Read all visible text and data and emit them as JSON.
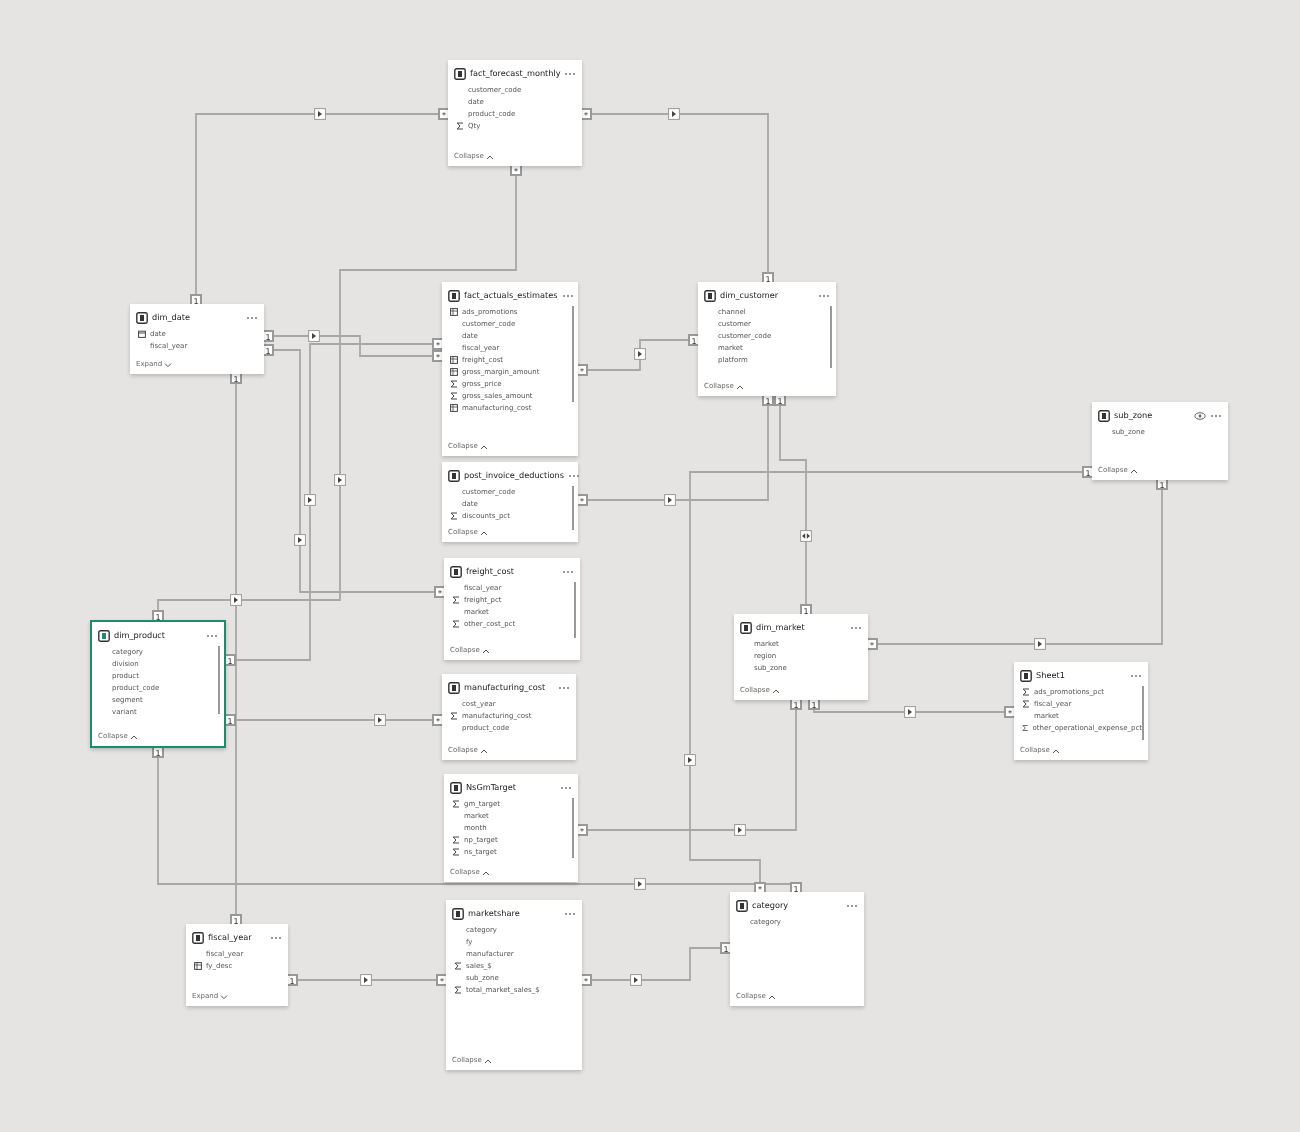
{
  "tables": [
    {
      "name": "fact_forecast_monthly",
      "selected": false,
      "hidden": false,
      "expanded": true,
      "footer": "Collapse",
      "fields": [
        {
          "name": "customer_code",
          "kind": "column"
        },
        {
          "name": "date",
          "kind": "column"
        },
        {
          "name": "product_code",
          "kind": "column"
        },
        {
          "name": "Qty",
          "kind": "measure"
        }
      ]
    },
    {
      "name": "dim_date",
      "selected": false,
      "hidden": false,
      "expanded": false,
      "footer": "Expand",
      "fields": [
        {
          "name": "date",
          "kind": "date"
        },
        {
          "name": "fiscal_year",
          "kind": "column"
        }
      ]
    },
    {
      "name": "fact_actuals_estimates",
      "selected": false,
      "hidden": false,
      "expanded": true,
      "footer": "Collapse",
      "fields": [
        {
          "name": "ads_promotions",
          "kind": "calculated"
        },
        {
          "name": "customer_code",
          "kind": "column"
        },
        {
          "name": "date",
          "kind": "column"
        },
        {
          "name": "fiscal_year",
          "kind": "column"
        },
        {
          "name": "freight_cost",
          "kind": "calculated"
        },
        {
          "name": "gross_margin_amount",
          "kind": "calculated"
        },
        {
          "name": "gross_price",
          "kind": "measure"
        },
        {
          "name": "gross_sales_amount",
          "kind": "measure"
        },
        {
          "name": "manufacturing_cost",
          "kind": "calculated"
        }
      ]
    },
    {
      "name": "post_invoice_deductions",
      "selected": false,
      "hidden": false,
      "expanded": true,
      "footer": "Collapse",
      "fields": [
        {
          "name": "customer_code",
          "kind": "column"
        },
        {
          "name": "date",
          "kind": "column"
        },
        {
          "name": "discounts_pct",
          "kind": "measure"
        }
      ]
    },
    {
      "name": "freight_cost",
      "selected": false,
      "hidden": false,
      "expanded": true,
      "footer": "Collapse",
      "fields": [
        {
          "name": "fiscal_year",
          "kind": "column"
        },
        {
          "name": "freight_pct",
          "kind": "measure"
        },
        {
          "name": "market",
          "kind": "column"
        },
        {
          "name": "other_cost_pct",
          "kind": "measure"
        }
      ]
    },
    {
      "name": "manufacturing_cost",
      "selected": false,
      "hidden": false,
      "expanded": true,
      "footer": "Collapse",
      "fields": [
        {
          "name": "cost_year",
          "kind": "column"
        },
        {
          "name": "manufacturing_cost",
          "kind": "measure"
        },
        {
          "name": "product_code",
          "kind": "column"
        }
      ]
    },
    {
      "name": "NsGmTarget",
      "selected": false,
      "hidden": false,
      "expanded": true,
      "footer": "Collapse",
      "fields": [
        {
          "name": "gm_target",
          "kind": "measure"
        },
        {
          "name": "market",
          "kind": "column"
        },
        {
          "name": "month",
          "kind": "column"
        },
        {
          "name": "np_target",
          "kind": "measure"
        },
        {
          "name": "ns_target",
          "kind": "measure"
        }
      ]
    },
    {
      "name": "marketshare",
      "selected": false,
      "hidden": false,
      "expanded": true,
      "footer": "Collapse",
      "fields": [
        {
          "name": "category",
          "kind": "column"
        },
        {
          "name": "fy",
          "kind": "column"
        },
        {
          "name": "manufacturer",
          "kind": "column"
        },
        {
          "name": "sales_$",
          "kind": "measure"
        },
        {
          "name": "sub_zone",
          "kind": "column"
        },
        {
          "name": "total_market_sales_$",
          "kind": "measure"
        }
      ]
    },
    {
      "name": "dim_customer",
      "selected": false,
      "hidden": false,
      "expanded": true,
      "footer": "Collapse",
      "fields": [
        {
          "name": "channel",
          "kind": "column"
        },
        {
          "name": "customer",
          "kind": "column"
        },
        {
          "name": "customer_code",
          "kind": "column"
        },
        {
          "name": "market",
          "kind": "column"
        },
        {
          "name": "platform",
          "kind": "column"
        }
      ]
    },
    {
      "name": "sub_zone",
      "selected": false,
      "hidden": true,
      "expanded": true,
      "footer": "Collapse",
      "fields": [
        {
          "name": "sub_zone",
          "kind": "column"
        }
      ]
    },
    {
      "name": "dim_product",
      "selected": true,
      "hidden": false,
      "expanded": true,
      "footer": "Collapse",
      "fields": [
        {
          "name": "category",
          "kind": "column"
        },
        {
          "name": "division",
          "kind": "column"
        },
        {
          "name": "product",
          "kind": "column"
        },
        {
          "name": "product_code",
          "kind": "column"
        },
        {
          "name": "segment",
          "kind": "column"
        },
        {
          "name": "variant",
          "kind": "column"
        }
      ]
    },
    {
      "name": "dim_market",
      "selected": false,
      "hidden": false,
      "expanded": true,
      "footer": "Collapse",
      "fields": [
        {
          "name": "market",
          "kind": "column"
        },
        {
          "name": "region",
          "kind": "column"
        },
        {
          "name": "sub_zone",
          "kind": "column"
        }
      ]
    },
    {
      "name": "Sheet1",
      "selected": false,
      "hidden": false,
      "expanded": true,
      "footer": "Collapse",
      "fields": [
        {
          "name": "ads_promotions_pct",
          "kind": "measure"
        },
        {
          "name": "fiscal_year",
          "kind": "measure"
        },
        {
          "name": "market",
          "kind": "column"
        },
        {
          "name": "other_operational_expense_pct",
          "kind": "measure"
        }
      ]
    },
    {
      "name": "fiscal_year",
      "selected": false,
      "hidden": false,
      "expanded": false,
      "footer": "Expand",
      "fields": [
        {
          "name": "fiscal_year",
          "kind": "column"
        },
        {
          "name": "fy_desc",
          "kind": "calculated"
        }
      ]
    },
    {
      "name": "category",
      "selected": false,
      "hidden": false,
      "expanded": true,
      "footer": "Collapse",
      "fields": [
        {
          "name": "category",
          "kind": "column"
        }
      ]
    }
  ],
  "relationships": [
    {
      "from_end": "*",
      "to_end": "1",
      "bidirectional": false
    },
    {
      "from_end": "*",
      "to_end": "1",
      "bidirectional": false
    },
    {
      "from_end": "*",
      "to_end": "1",
      "bidirectional": false
    },
    {
      "from_end": "1",
      "to_end": "*",
      "bidirectional": false
    },
    {
      "from_end": "*",
      "to_end": "1",
      "bidirectional": false
    },
    {
      "from_end": "*",
      "to_end": "1",
      "bidirectional": false
    },
    {
      "from_end": "1",
      "to_end": "1",
      "bidirectional": true
    },
    {
      "from_end": "1",
      "to_end": "*",
      "bidirectional": false
    },
    {
      "from_end": "1",
      "to_end": "*",
      "bidirectional": false
    },
    {
      "from_end": "1",
      "to_end": "*",
      "bidirectional": false
    },
    {
      "from_end": "1",
      "to_end": "*",
      "bidirectional": false
    },
    {
      "from_end": "1",
      "to_end": "*",
      "bidirectional": false
    },
    {
      "from_end": "1",
      "to_end": "*",
      "bidirectional": false
    },
    {
      "from_end": "1",
      "to_end": "1",
      "bidirectional": false
    },
    {
      "from_end": "1",
      "to_end": "*",
      "bidirectional": false
    },
    {
      "from_end": "1",
      "to_end": "1",
      "bidirectional": false
    },
    {
      "from_end": "*",
      "to_end": "1",
      "bidirectional": false
    },
    {
      "from_end": "1",
      "to_end": "*",
      "bidirectional": false
    }
  ]
}
